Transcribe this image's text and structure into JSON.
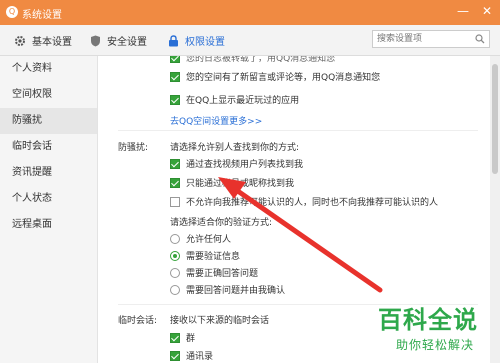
{
  "window": {
    "title": "系统设置",
    "logo_glyph": "Q",
    "minimize_glyph": "—",
    "close_glyph": "✕"
  },
  "tabs": [
    {
      "label": "基本设置",
      "icon": "gear-icon",
      "active": false
    },
    {
      "label": "安全设置",
      "icon": "shield-icon",
      "active": false
    },
    {
      "label": "权限设置",
      "icon": "lock-icon",
      "active": true
    }
  ],
  "search": {
    "placeholder": "搜索设置项"
  },
  "sidebar": {
    "items": [
      {
        "label": "个人资料",
        "active": false
      },
      {
        "label": "空间权限",
        "active": false
      },
      {
        "label": "防骚扰",
        "active": true
      },
      {
        "label": "临时会话",
        "active": false
      },
      {
        "label": "资讯提醒",
        "active": false
      },
      {
        "label": "个人状态",
        "active": false
      },
      {
        "label": "远程桌面",
        "active": false
      }
    ]
  },
  "space": {
    "cut_off_text": "您的日志被转载了，用QQ消息通知您",
    "opt_new_comment": "您的空间有了新留言或评论等，用QQ消息通知您",
    "opt_show_app": "在QQ上显示最近玩过的应用",
    "more_link": "去QQ空间设置更多>>"
  },
  "harass": {
    "section_label": "防骚扰:",
    "find_prompt": "请选择允许别人查找到你的方式:",
    "find_options": [
      {
        "label": "通过查找视频用户列表找到我",
        "checked": true
      },
      {
        "label": "只能通过帐号或昵称找到我",
        "checked": true
      },
      {
        "label": "不允许向我推荐可能认识的人，同时也不向我推荐可能认识的人",
        "checked": false
      }
    ],
    "verify_prompt": "请选择适合你的验证方式:",
    "verify_options": [
      {
        "label": "允许任何人",
        "selected": false
      },
      {
        "label": "需要验证信息",
        "selected": true
      },
      {
        "label": "需要正确回答问题",
        "selected": false
      },
      {
        "label": "需要回答问题并由我确认",
        "selected": false
      }
    ]
  },
  "temp_session": {
    "section_label": "临时会话:",
    "prompt": "接收以下来源的临时会话",
    "options": [
      {
        "label": "群",
        "checked": true
      },
      {
        "label": "通讯录",
        "checked": true
      }
    ]
  },
  "watermark": {
    "title": "百科全说",
    "subtitle": "助你轻松解决"
  },
  "colors": {
    "title_bar": "#f08a42",
    "accent": "#2a6fd6",
    "check": "#36a33a",
    "arrow": "#e8322c",
    "watermark": "#2ea84b"
  }
}
